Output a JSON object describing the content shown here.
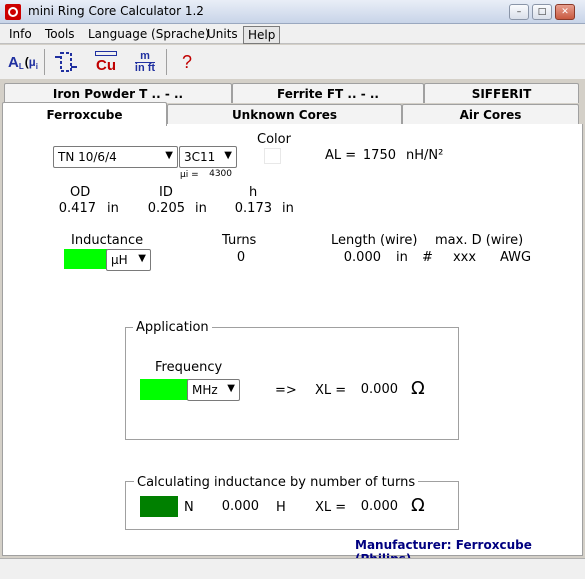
{
  "window": {
    "title": "mini Ring Core Calculator 1.2"
  },
  "menu": {
    "items": [
      "Info",
      "Tools",
      "Language (Sprache)",
      "Units",
      "Help"
    ]
  },
  "toolbar": {
    "al_label": "A",
    "al_sub": "L",
    "mu_label": "µ",
    "mu_sub": "i",
    "cu_label": "Cu",
    "m_label": "m",
    "inft_label": "in ft",
    "help_label": "?"
  },
  "tabs": {
    "row1": [
      "Iron Powder T .. - ..",
      "Ferrite FT .. - ..",
      "SIFFERIT"
    ],
    "row2": [
      "Ferroxcube",
      "Unknown Cores",
      "Air Cores"
    ]
  },
  "core": {
    "type_value": "TN 10/6/4",
    "material_value": "3C11",
    "mu_i_label": "µi =",
    "mu_i_value": "4300",
    "color_label": "Color",
    "al_label": "AL =",
    "al_value": "1750",
    "al_unit": "nH/N²"
  },
  "dims": {
    "od_label": "OD",
    "od_value": "0.417",
    "od_unit": "in",
    "id_label": "ID",
    "id_value": "0.205",
    "id_unit": "in",
    "h_label": "h",
    "h_value": "0.173",
    "h_unit": "in"
  },
  "inductance": {
    "label": "Inductance",
    "unit": "µH"
  },
  "turns": {
    "label": "Turns",
    "value": "0"
  },
  "length": {
    "label": "Length (wire)",
    "value": "0.000",
    "unit": "in"
  },
  "maxd": {
    "label": "max. D (wire)",
    "hash": "#",
    "value": "xxx",
    "unit": "AWG"
  },
  "application": {
    "title": "Application",
    "freq_label": "Frequency",
    "freq_unit": "MHz",
    "arrow": "=>",
    "xl_label": "XL =",
    "xl_value": "0.000",
    "ohm": "Ω"
  },
  "calc": {
    "title": "Calculating inductance by number of turns",
    "n_label": "N",
    "n_value": "0.000",
    "h_unit": "H",
    "xl_label": "XL =",
    "xl_value": "0.000",
    "ohm": "Ω"
  },
  "manufacturer": "Manufacturer: Ferroxcube (Philips)",
  "colors": {
    "green_field": "#00ff00",
    "dark_green": "#008000",
    "link_blue": "#000080",
    "app_red": "#cc0000"
  }
}
